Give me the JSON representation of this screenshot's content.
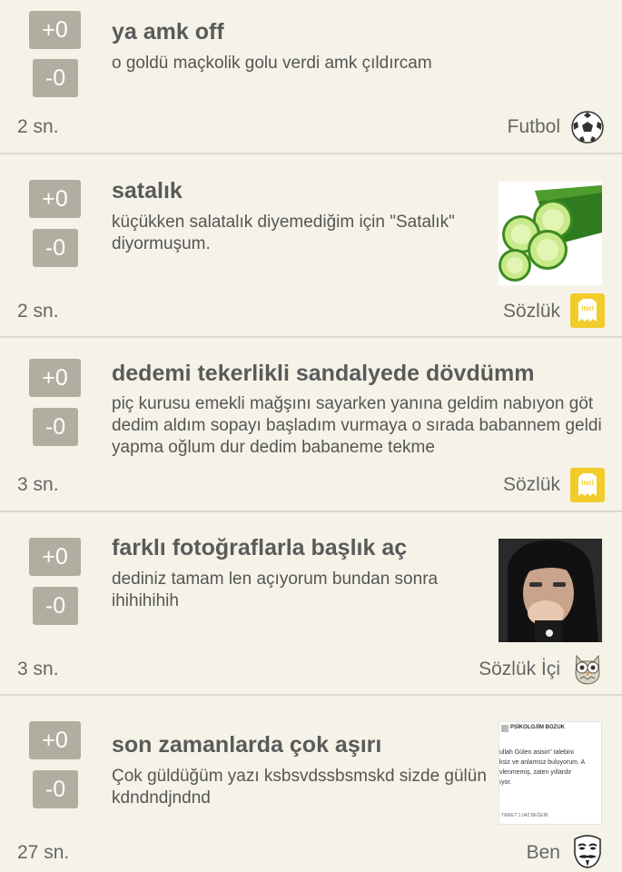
{
  "vote": {
    "plus": "+0",
    "minus": "-0"
  },
  "entries": [
    {
      "title": "ya amk off",
      "body": "o goldü maçkolik golu verdi amk çıldırcam",
      "time": "2 sn.",
      "category": "Futbol",
      "icon": "soccer-ball-icon"
    },
    {
      "title": "satalık",
      "body": "küçükken salatalık diyemediğim için \"Satalık\" diyormuşum.",
      "time": "2 sn.",
      "category": "Sözlük",
      "icon": "inci-owl-icon",
      "thumbnail": "cucumber-slices-photo"
    },
    {
      "title": "dedemi tekerlikli sandalyede dövdümm",
      "body": "piç kurusu emekli mağşını sayarken yanına geldim nabıyon göt dedim aldım sopayı başladım vurmaya o sırada babannem geldi yapma oğlum dur dedim babaneme tekme",
      "time": "3 sn.",
      "category": "Sözlük",
      "icon": "inci-owl-icon"
    },
    {
      "title": "farklı fotoğraflarla başlık aç",
      "body": "dediniz tamam len açıyorum bundan sonra ihihihihih",
      "time": "3 sn.",
      "category": "Sözlük İçi",
      "icon": "owl-icon",
      "thumbnail": "portrait-photo"
    },
    {
      "title": "son zamanlarda çok aşırı",
      "body": "Çok güldüğüm yazı ksbsvdssbsmskd sizde gülün kdndndjndnd",
      "time": "27 sn.",
      "category": "Ben",
      "icon": "guy-fawkes-mask-icon",
      "thumbnail": "tweet-screenshot",
      "thumbnail_text": {
        "name": "PSİKOLOJİM BOZUK",
        "line1": "ullah Gülen asisin\" talebini",
        "line2": "ksiz ve anlamsız buluyorum. A",
        "line3": "vlenmemiş, zaten yıllardır",
        "line4": "ıyor.",
        "footer": "TWEET 1.042 BEĞENİ"
      }
    }
  ]
}
